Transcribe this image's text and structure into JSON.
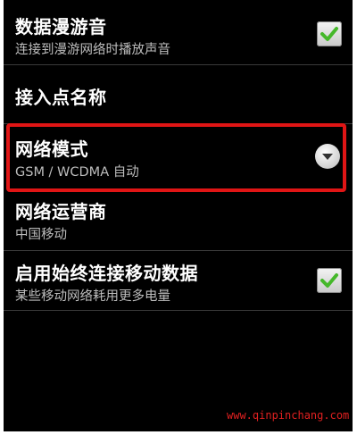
{
  "settings": {
    "roaming_sound": {
      "title": "数据漫游音",
      "subtitle": "连接到漫游网络时播放声音",
      "checked": true
    },
    "apn": {
      "title": "接入点名称"
    },
    "network_mode": {
      "title": "网络模式",
      "subtitle": "GSM / WCDMA 自动"
    },
    "operator": {
      "title": "网络运营商",
      "subtitle": "中国移动"
    },
    "always_on_data": {
      "title": "启用始终连接移动数据",
      "subtitle": "某些移动网络耗用更多电量",
      "checked": true
    }
  },
  "icons": {
    "checkbox": "check-icon",
    "dropdown": "chevron-down-icon"
  },
  "colors": {
    "background": "#000000",
    "highlight": "#e01515",
    "check": "#45b82a"
  },
  "watermark": "www.qinpinchang.com"
}
